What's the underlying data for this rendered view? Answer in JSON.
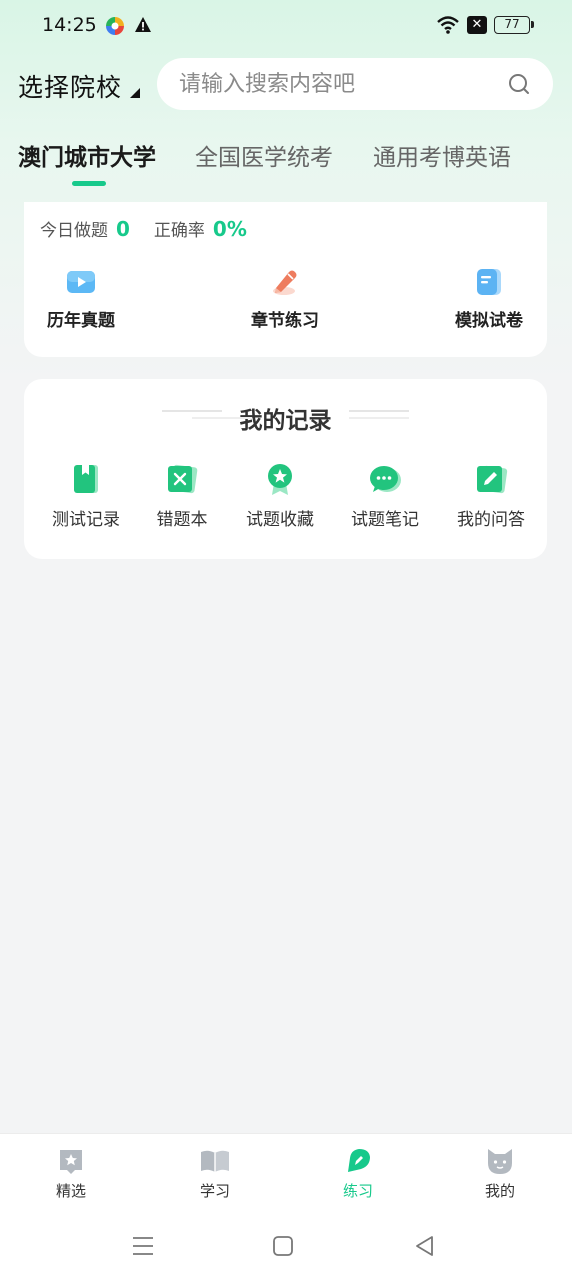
{
  "status_bar": {
    "time": "14:25",
    "battery": "77"
  },
  "header": {
    "school_label": "选择院校",
    "search_placeholder": "请输入搜索内容吧"
  },
  "tabs": [
    {
      "label": "澳门城市大学",
      "active": true
    },
    {
      "label": "全国医学统考",
      "active": false
    },
    {
      "label": "通用考博英语",
      "active": false
    }
  ],
  "stats": {
    "today_label": "今日做题",
    "today_value": "0",
    "accuracy_label": "正确率",
    "accuracy_value": "0%"
  },
  "practice_actions": [
    {
      "label": "历年真题",
      "icon": "video-play-icon"
    },
    {
      "label": "章节练习",
      "icon": "pencil-icon"
    },
    {
      "label": "模拟试卷",
      "icon": "paper-icon"
    }
  ],
  "records": {
    "title": "我的记录",
    "items": [
      {
        "label": "测试记录",
        "icon": "bookmark-book-icon"
      },
      {
        "label": "错题本",
        "icon": "wrong-book-icon"
      },
      {
        "label": "试题收藏",
        "icon": "star-badge-icon"
      },
      {
        "label": "试题笔记",
        "icon": "chat-bubble-icon"
      },
      {
        "label": "我的问答",
        "icon": "edit-note-icon"
      }
    ]
  },
  "bottom_nav": [
    {
      "label": "精选",
      "icon": "featured-icon",
      "active": false
    },
    {
      "label": "学习",
      "icon": "open-book-icon",
      "active": false
    },
    {
      "label": "练习",
      "icon": "practice-icon",
      "active": true
    },
    {
      "label": "我的",
      "icon": "profile-cat-icon",
      "active": false
    }
  ],
  "colors": {
    "accent": "#17c98b",
    "background": "#f3f4f5",
    "header_tint": "#d9f5e6"
  }
}
